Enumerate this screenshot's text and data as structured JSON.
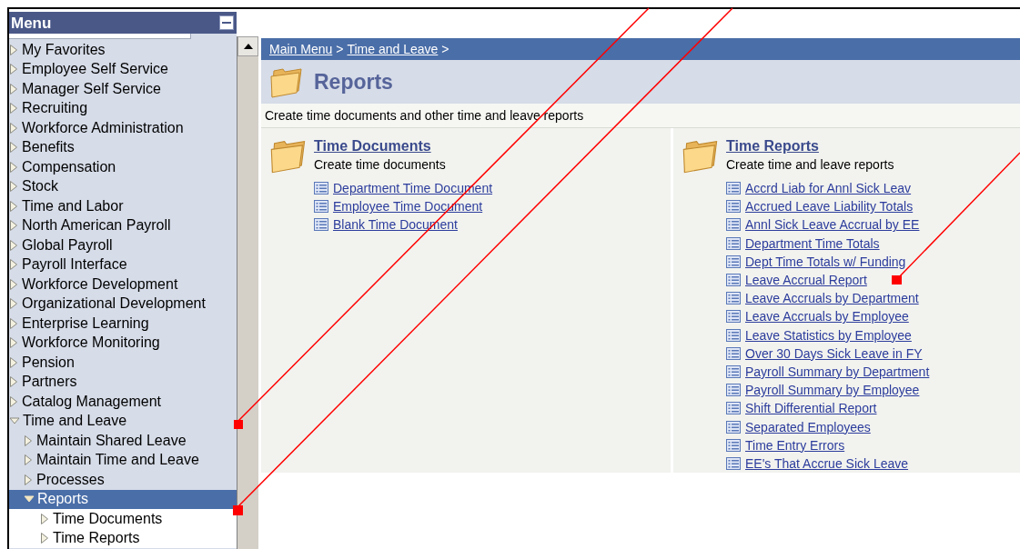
{
  "menu": {
    "title": "Menu",
    "items": [
      {
        "label": "My Favorites",
        "expanded": false,
        "selected": false
      },
      {
        "label": "Employee Self Service",
        "expanded": false,
        "selected": false
      },
      {
        "label": "Manager Self Service",
        "expanded": false,
        "selected": false
      },
      {
        "label": "Recruiting",
        "expanded": false,
        "selected": false
      },
      {
        "label": "Workforce Administration",
        "expanded": false,
        "selected": false
      },
      {
        "label": "Benefits",
        "expanded": false,
        "selected": false
      },
      {
        "label": "Compensation",
        "expanded": false,
        "selected": false
      },
      {
        "label": "Stock",
        "expanded": false,
        "selected": false
      },
      {
        "label": "Time and Labor",
        "expanded": false,
        "selected": false
      },
      {
        "label": "North American Payroll",
        "expanded": false,
        "selected": false
      },
      {
        "label": "Global Payroll",
        "expanded": false,
        "selected": false
      },
      {
        "label": "Payroll Interface",
        "expanded": false,
        "selected": false
      },
      {
        "label": "Workforce Development",
        "expanded": false,
        "selected": false
      },
      {
        "label": "Organizational Development",
        "expanded": false,
        "selected": false
      },
      {
        "label": "Enterprise Learning",
        "expanded": false,
        "selected": false
      },
      {
        "label": "Workforce Monitoring",
        "expanded": false,
        "selected": false
      },
      {
        "label": "Pension",
        "expanded": false,
        "selected": false
      },
      {
        "label": "Partners",
        "expanded": false,
        "selected": false
      },
      {
        "label": "Catalog Management",
        "expanded": false,
        "selected": false
      },
      {
        "label": "Time and Leave",
        "expanded": true,
        "selected": false,
        "children": [
          {
            "label": "Maintain Shared Leave",
            "expanded": false,
            "selected": false
          },
          {
            "label": "Maintain Time and Leave",
            "expanded": false,
            "selected": false
          },
          {
            "label": "Processes",
            "expanded": false,
            "selected": false
          },
          {
            "label": "Reports",
            "expanded": true,
            "selected": true,
            "children": [
              {
                "label": "Time Documents",
                "expanded": false,
                "selected": false
              },
              {
                "label": "Time Reports",
                "expanded": false,
                "selected": false
              }
            ]
          }
        ]
      }
    ]
  },
  "breadcrumb": {
    "links": [
      "Main Menu",
      "Time and Leave"
    ],
    "separator": ">"
  },
  "page": {
    "title": "Reports",
    "description": "Create time documents and other time and leave reports"
  },
  "sections": [
    {
      "title": "Time Documents",
      "description": "Create time documents",
      "links": [
        "Department Time Document",
        "Employee Time Document",
        "Blank Time Document"
      ]
    },
    {
      "title": "Time Reports",
      "description": "Create time and leave reports",
      "links": [
        "Accrd Liab for Annl Sick Leav",
        "Accrued Leave Liability Totals",
        "Annl Sick Leave Accrual by EE",
        "Department Time Totals",
        "Dept Time Totals w/ Funding",
        "Leave Accrual Report",
        "Leave Accruals by Department",
        "Leave Accruals by Employee",
        "Leave Statistics by Employee",
        "Over 30 Days Sick Leave in FY",
        "Payroll Summary by Department",
        "Payroll Summary by Employee",
        "Shift Differential Report",
        "Separated Employees",
        "Time Entry Errors",
        "EE's That Accrue Sick Leave"
      ]
    }
  ]
}
